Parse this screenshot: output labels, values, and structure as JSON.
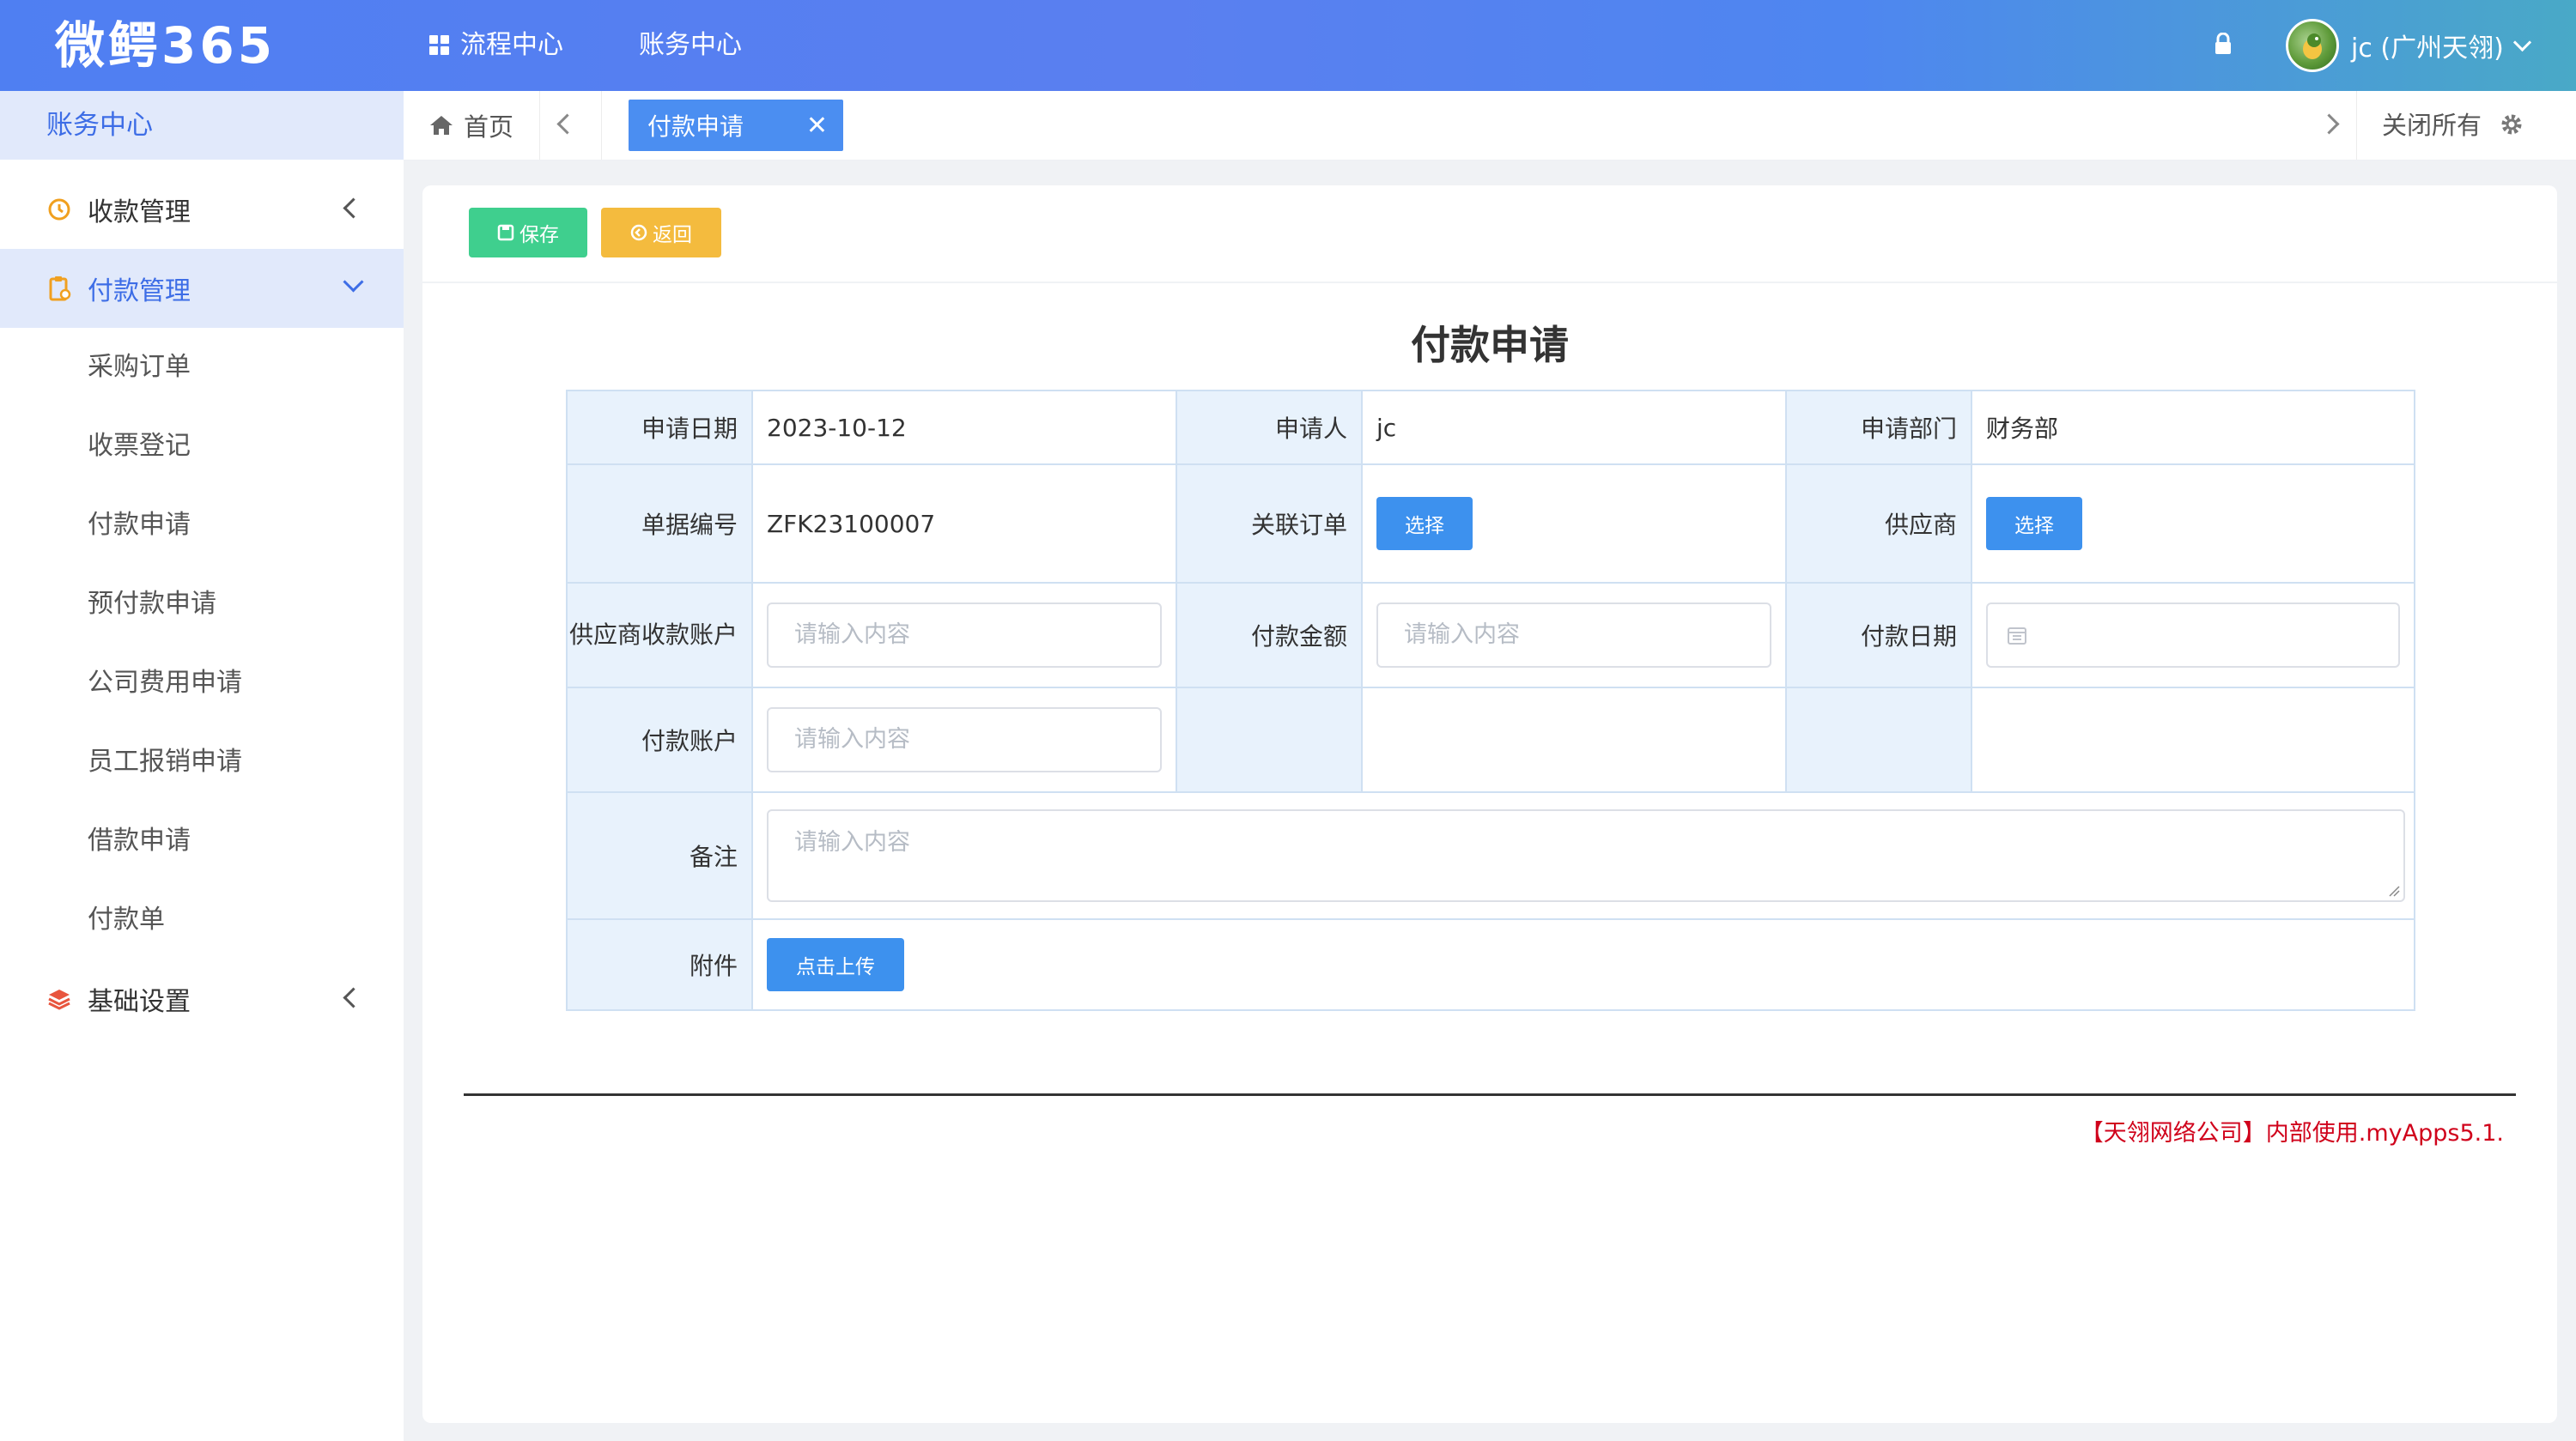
{
  "header": {
    "logo": "微鳄365",
    "nav": [
      "流程中心",
      "账务中心"
    ],
    "user_name": "jc (广州天翎)"
  },
  "sidebar": {
    "title": "账务中心",
    "groups": [
      {
        "label": "收款管理",
        "icon": "collection-icon",
        "expanded": false
      },
      {
        "label": "付款管理",
        "icon": "clipboard-icon",
        "expanded": true,
        "items": [
          "采购订单",
          "收票登记",
          "付款申请",
          "预付款申请",
          "公司费用申请",
          "员工报销申请",
          "借款申请",
          "付款单"
        ]
      },
      {
        "label": "基础设置",
        "icon": "layers-icon",
        "expanded": false
      }
    ]
  },
  "tabs": {
    "home": "首页",
    "active": "付款申请",
    "close_all": "关闭所有"
  },
  "toolbar": {
    "save": "保存",
    "back": "返回"
  },
  "form": {
    "title": "付款申请",
    "labels": {
      "apply_date": "申请日期",
      "applicant": "申请人",
      "department": "申请部门",
      "doc_no": "单据编号",
      "related_order": "关联订单",
      "supplier": "供应商",
      "supplier_account": "供应商收款账户",
      "amount": "付款金额",
      "pay_date": "付款日期",
      "pay_account": "付款账户",
      "remark": "备注",
      "attachment": "附件"
    },
    "values": {
      "apply_date": "2023-10-12",
      "applicant": "jc",
      "department": "财务部",
      "doc_no": "ZFK23100007"
    },
    "placeholder": "请输入内容",
    "select_label": "选择",
    "upload_label": "点击上传"
  },
  "footer": {
    "text": "【天翎网络公司】内部使用.myApps5.1."
  },
  "colors": {
    "accent": "#3d6de6",
    "save_button": "#3fcf8e",
    "back_button": "#f4bb3e",
    "primary_button": "#3d91ee",
    "footer_text": "#d0021b"
  }
}
